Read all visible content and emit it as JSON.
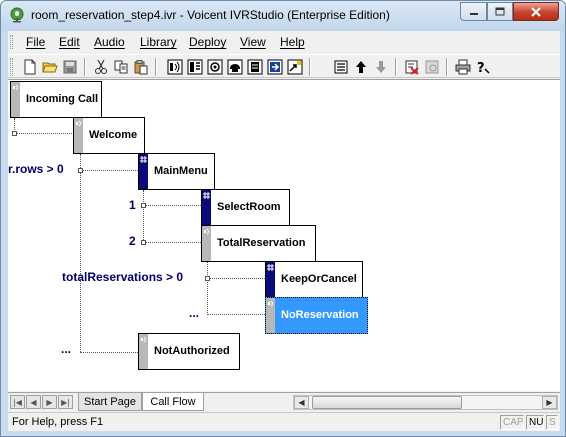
{
  "window": {
    "title": "room_reservation_step4.ivr - Voicent IVRStudio (Enterprise Edition)"
  },
  "menubar": {
    "items": [
      {
        "label": "File"
      },
      {
        "label": "Edit"
      },
      {
        "label": "Audio"
      },
      {
        "label": "Library"
      },
      {
        "label": "Deploy"
      },
      {
        "label": "View"
      },
      {
        "label": "Help"
      }
    ]
  },
  "toolbar": {
    "icons": [
      "new-icon",
      "open-icon",
      "save-icon",
      "cut-icon",
      "copy-icon",
      "paste-icon",
      "prompt-node-icon",
      "menu-node-icon",
      "record-node-icon",
      "transfer-node-icon",
      "database-node-icon",
      "goto-node-icon",
      "properties-icon",
      "move-up-icon",
      "move-down-icon",
      "validate-icon",
      "disabled-tool-icon",
      "print-icon",
      "help-icon"
    ]
  },
  "callflow": {
    "nodes": [
      {
        "label": "Incoming Call",
        "kind": "prompt"
      },
      {
        "label": "Welcome",
        "kind": "prompt"
      },
      {
        "label": "MainMenu",
        "kind": "menu"
      },
      {
        "label": "SelectRoom",
        "kind": "menu"
      },
      {
        "label": "TotalReservation",
        "kind": "prompt"
      },
      {
        "label": "KeepOrCancel",
        "kind": "menu"
      },
      {
        "label": "NoReservation",
        "kind": "prompt",
        "selected": true
      },
      {
        "label": "NotAuthorized",
        "kind": "prompt"
      }
    ],
    "conditions": {
      "rows": "r.rows > 0",
      "key1": "1",
      "key2": "2",
      "total": "totalReservations > 0",
      "else1": "...",
      "else2": "..."
    }
  },
  "tabs": {
    "start_page": "Start Page",
    "call_flow": "Call Flow",
    "active": "Call Flow"
  },
  "statusbar": {
    "text": "For Help, press F1",
    "caps": "CAP",
    "num": "NU",
    "scrl": "S"
  },
  "colors": {
    "selection": "#3399ff",
    "menu_strip": "#0a0a7a",
    "condition_text": "#000066",
    "close_button": "#c8442e"
  }
}
